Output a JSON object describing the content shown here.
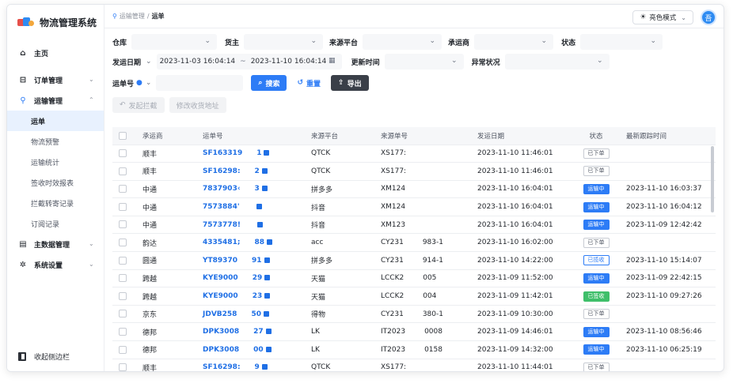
{
  "app": {
    "title": "物流管理系统"
  },
  "sidebar": {
    "items": [
      {
        "label": "主页",
        "icon": "home-icon"
      },
      {
        "label": "订单管理",
        "icon": "cart-icon"
      },
      {
        "label": "运输管理",
        "icon": "route-icon"
      },
      {
        "label": "主数据管理",
        "icon": "database-icon"
      },
      {
        "label": "系统设置",
        "icon": "gear-icon"
      }
    ],
    "sub_items": [
      "运单",
      "物流预警",
      "运输统计",
      "签收时效报表",
      "拦截转寄记录",
      "订阅记录"
    ],
    "collapse_label": "收起侧边栏"
  },
  "topbar": {
    "breadcrumb_parent": "运输管理",
    "breadcrumb_sep": "/",
    "breadcrumb_current": "运单",
    "theme_label": "亮色模式",
    "avatar_letter": "吾"
  },
  "filters": {
    "warehouse_label": "仓库",
    "owner_label": "货主",
    "source_platform_label": "来源平台",
    "carrier_label": "承运商",
    "status_label": "状态",
    "ship_date_label": "发运日期",
    "date_start": "2023-11-03 16:04:14",
    "date_tilde": "~",
    "date_end": "2023-11-10 16:04:14",
    "update_time_label": "更新时间",
    "exception_label": "异常状况",
    "waybill_label": "运单号",
    "search_button": "搜索",
    "reset_button": "重置",
    "export_button": "导出",
    "intercept_button": "发起拦截",
    "modify_address_button": "修改收货地址"
  },
  "table": {
    "columns": [
      "承运商",
      "运单号",
      "来源平台",
      "来源单号",
      "发运日期",
      "状态",
      "最新跟踪时间"
    ],
    "rows": [
      {
        "carrier": "顺丰",
        "waybill": "SF163319",
        "waybill_tail": "1",
        "platform": "QTCK",
        "source_no": "XS177:",
        "source_tail": "",
        "ship_date": "2023-11-10 11:46:01",
        "status": "已下单",
        "status_style": "plain",
        "latest": ""
      },
      {
        "carrier": "顺丰",
        "waybill": "SF16298:",
        "waybill_tail": "2",
        "platform": "QTCK",
        "source_no": "XS177:",
        "source_tail": "",
        "ship_date": "2023-11-10 11:46:01",
        "status": "已下单",
        "status_style": "plain",
        "latest": ""
      },
      {
        "carrier": "中通",
        "waybill": "7837903‹",
        "waybill_tail": "3",
        "platform": "拼多多",
        "source_no": "XM124",
        "source_tail": "",
        "ship_date": "2023-11-10 16:04:01",
        "status": "运输中",
        "status_style": "blue",
        "latest": "2023-11-10 16:03:37"
      },
      {
        "carrier": "中通",
        "waybill": "7573884'",
        "waybill_tail": "",
        "platform": "抖音",
        "source_no": "XM124",
        "source_tail": "",
        "ship_date": "2023-11-10 16:04:01",
        "status": "运输中",
        "status_style": "blue",
        "latest": "2023-11-10 16:04:12"
      },
      {
        "carrier": "中通",
        "waybill": "7573778!",
        "waybill_tail": "",
        "platform": "抖音",
        "source_no": "XM123",
        "source_tail": "",
        "ship_date": "2023-11-10 16:04:01",
        "status": "运输中",
        "status_style": "blue",
        "latest": "2023-11-09 12:42:42"
      },
      {
        "carrier": "韵达",
        "waybill": "4335481;",
        "waybill_tail": "88",
        "platform": "acc",
        "source_no": "CY231",
        "source_tail": "983-1",
        "ship_date": "2023-11-10 16:02:00",
        "status": "已下单",
        "status_style": "plain",
        "latest": ""
      },
      {
        "carrier": "圆通",
        "waybill": "YT89370",
        "waybill_tail": "91",
        "platform": "拼多多",
        "source_no": "CY231",
        "source_tail": "914-1",
        "ship_date": "2023-11-10 14:22:00",
        "status": "已揽收",
        "status_style": "outline-blue",
        "latest": "2023-11-10 15:14:07"
      },
      {
        "carrier": "跨越",
        "waybill": "KYE9000",
        "waybill_tail": "29",
        "platform": "天猫",
        "source_no": "LCCK2",
        "source_tail": "005",
        "ship_date": "2023-11-09 11:52:00",
        "status": "运输中",
        "status_style": "blue",
        "latest": "2023-11-09 22:42:15"
      },
      {
        "carrier": "跨越",
        "waybill": "KYE9000",
        "waybill_tail": "23",
        "platform": "天猫",
        "source_no": "LCCK2",
        "source_tail": "004",
        "ship_date": "2023-11-09 11:42:01",
        "status": "已签收",
        "status_style": "green",
        "latest": "2023-11-10 09:27:26"
      },
      {
        "carrier": "京东",
        "waybill": "JDVB258",
        "waybill_tail": "50",
        "platform": "得物",
        "source_no": "CY231",
        "source_tail": "380-1",
        "ship_date": "2023-11-09 10:30:00",
        "status": "已下单",
        "status_style": "plain",
        "latest": ""
      },
      {
        "carrier": "德邦",
        "waybill": "DPK3008",
        "waybill_tail": "27",
        "platform": "LK",
        "source_no": "IT2023",
        "source_tail": "0008",
        "ship_date": "2023-11-09 14:46:01",
        "status": "运输中",
        "status_style": "blue",
        "latest": "2023-11-10 08:56:46"
      },
      {
        "carrier": "德邦",
        "waybill": "DPK3008",
        "waybill_tail": "00",
        "platform": "LK",
        "source_no": "IT2023",
        "source_tail": "0158",
        "ship_date": "2023-11-09 14:32:00",
        "status": "运输中",
        "status_style": "blue",
        "latest": "2023-11-10 06:25:19"
      },
      {
        "carrier": "顺丰",
        "waybill": "SF16298:",
        "waybill_tail": "9",
        "platform": "QTCK",
        "source_no": "XS177:",
        "source_tail": "",
        "ship_date": "2023-11-10 11:44:01",
        "status": "已下单",
        "status_style": "plain",
        "latest": ""
      }
    ]
  },
  "colors": {
    "accent": "#2d7cf6",
    "success": "#3fbf6a",
    "active_bg": "#e8f1fe"
  }
}
